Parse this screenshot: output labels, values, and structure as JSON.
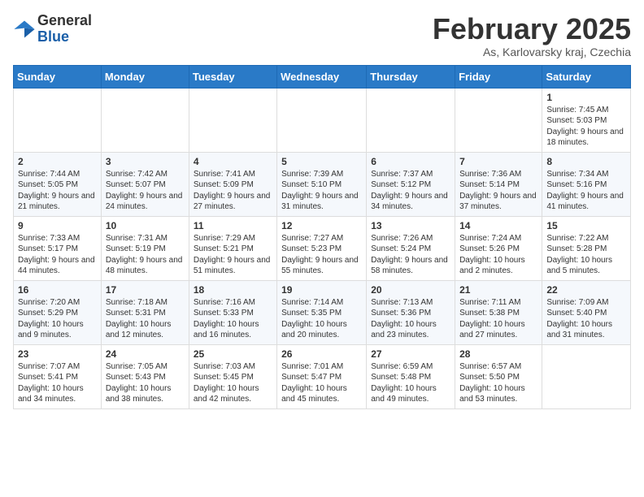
{
  "logo": {
    "general": "General",
    "blue": "Blue"
  },
  "header": {
    "month": "February 2025",
    "location": "As, Karlovarsky kraj, Czechia"
  },
  "weekdays": [
    "Sunday",
    "Monday",
    "Tuesday",
    "Wednesday",
    "Thursday",
    "Friday",
    "Saturday"
  ],
  "weeks": [
    [
      {
        "day": "",
        "info": ""
      },
      {
        "day": "",
        "info": ""
      },
      {
        "day": "",
        "info": ""
      },
      {
        "day": "",
        "info": ""
      },
      {
        "day": "",
        "info": ""
      },
      {
        "day": "",
        "info": ""
      },
      {
        "day": "1",
        "info": "Sunrise: 7:45 AM\nSunset: 5:03 PM\nDaylight: 9 hours and 18 minutes."
      }
    ],
    [
      {
        "day": "2",
        "info": "Sunrise: 7:44 AM\nSunset: 5:05 PM\nDaylight: 9 hours and 21 minutes."
      },
      {
        "day": "3",
        "info": "Sunrise: 7:42 AM\nSunset: 5:07 PM\nDaylight: 9 hours and 24 minutes."
      },
      {
        "day": "4",
        "info": "Sunrise: 7:41 AM\nSunset: 5:09 PM\nDaylight: 9 hours and 27 minutes."
      },
      {
        "day": "5",
        "info": "Sunrise: 7:39 AM\nSunset: 5:10 PM\nDaylight: 9 hours and 31 minutes."
      },
      {
        "day": "6",
        "info": "Sunrise: 7:37 AM\nSunset: 5:12 PM\nDaylight: 9 hours and 34 minutes."
      },
      {
        "day": "7",
        "info": "Sunrise: 7:36 AM\nSunset: 5:14 PM\nDaylight: 9 hours and 37 minutes."
      },
      {
        "day": "8",
        "info": "Sunrise: 7:34 AM\nSunset: 5:16 PM\nDaylight: 9 hours and 41 minutes."
      }
    ],
    [
      {
        "day": "9",
        "info": "Sunrise: 7:33 AM\nSunset: 5:17 PM\nDaylight: 9 hours and 44 minutes."
      },
      {
        "day": "10",
        "info": "Sunrise: 7:31 AM\nSunset: 5:19 PM\nDaylight: 9 hours and 48 minutes."
      },
      {
        "day": "11",
        "info": "Sunrise: 7:29 AM\nSunset: 5:21 PM\nDaylight: 9 hours and 51 minutes."
      },
      {
        "day": "12",
        "info": "Sunrise: 7:27 AM\nSunset: 5:23 PM\nDaylight: 9 hours and 55 minutes."
      },
      {
        "day": "13",
        "info": "Sunrise: 7:26 AM\nSunset: 5:24 PM\nDaylight: 9 hours and 58 minutes."
      },
      {
        "day": "14",
        "info": "Sunrise: 7:24 AM\nSunset: 5:26 PM\nDaylight: 10 hours and 2 minutes."
      },
      {
        "day": "15",
        "info": "Sunrise: 7:22 AM\nSunset: 5:28 PM\nDaylight: 10 hours and 5 minutes."
      }
    ],
    [
      {
        "day": "16",
        "info": "Sunrise: 7:20 AM\nSunset: 5:29 PM\nDaylight: 10 hours and 9 minutes."
      },
      {
        "day": "17",
        "info": "Sunrise: 7:18 AM\nSunset: 5:31 PM\nDaylight: 10 hours and 12 minutes."
      },
      {
        "day": "18",
        "info": "Sunrise: 7:16 AM\nSunset: 5:33 PM\nDaylight: 10 hours and 16 minutes."
      },
      {
        "day": "19",
        "info": "Sunrise: 7:14 AM\nSunset: 5:35 PM\nDaylight: 10 hours and 20 minutes."
      },
      {
        "day": "20",
        "info": "Sunrise: 7:13 AM\nSunset: 5:36 PM\nDaylight: 10 hours and 23 minutes."
      },
      {
        "day": "21",
        "info": "Sunrise: 7:11 AM\nSunset: 5:38 PM\nDaylight: 10 hours and 27 minutes."
      },
      {
        "day": "22",
        "info": "Sunrise: 7:09 AM\nSunset: 5:40 PM\nDaylight: 10 hours and 31 minutes."
      }
    ],
    [
      {
        "day": "23",
        "info": "Sunrise: 7:07 AM\nSunset: 5:41 PM\nDaylight: 10 hours and 34 minutes."
      },
      {
        "day": "24",
        "info": "Sunrise: 7:05 AM\nSunset: 5:43 PM\nDaylight: 10 hours and 38 minutes."
      },
      {
        "day": "25",
        "info": "Sunrise: 7:03 AM\nSunset: 5:45 PM\nDaylight: 10 hours and 42 minutes."
      },
      {
        "day": "26",
        "info": "Sunrise: 7:01 AM\nSunset: 5:47 PM\nDaylight: 10 hours and 45 minutes."
      },
      {
        "day": "27",
        "info": "Sunrise: 6:59 AM\nSunset: 5:48 PM\nDaylight: 10 hours and 49 minutes."
      },
      {
        "day": "28",
        "info": "Sunrise: 6:57 AM\nSunset: 5:50 PM\nDaylight: 10 hours and 53 minutes."
      },
      {
        "day": "",
        "info": ""
      }
    ]
  ]
}
